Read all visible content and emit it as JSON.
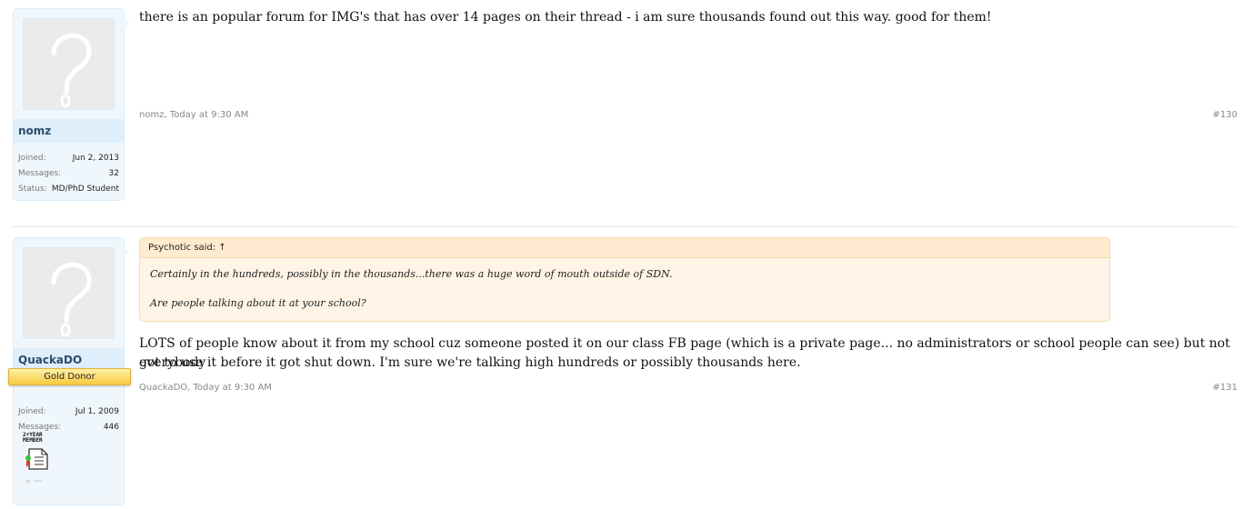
{
  "posts": [
    {
      "username": "nomz",
      "stats": [
        {
          "label": "Joined:",
          "value": "Jun 2, 2013"
        },
        {
          "label": "Messages:",
          "value": "32"
        },
        {
          "label": "Status:",
          "value": "MD/PhD Student"
        }
      ],
      "message": "there is an popular forum for IMG's that has over 14 pages on their thread - i am sure thousands found out this way. good for them!",
      "meta": "nomz, Today at 9:30 AM",
      "post_number": "#130"
    },
    {
      "username": "QuackaDO",
      "banner": "Gold Donor",
      "stats": [
        {
          "label": "Joined:",
          "value": "Jul 1, 2009"
        },
        {
          "label": "Messages:",
          "value": "446"
        }
      ],
      "badge_text": "2+YEAR MEMBER",
      "quote": {
        "author_line": "Psychotic said: ↑",
        "lines": [
          "Certainly in the hundreds, possibly in the thousands...there was a huge word of mouth outside of SDN.",
          "Are people talking about it at your school?"
        ]
      },
      "message_line1": "LOTS of people know about it from my school cuz someone posted it on our class FB page (which is a private page... no administrators or school people can see) but not everybody",
      "message_line2": "got to use it before it got shut down. I'm sure we're talking high hundreds or possibly thousands here.",
      "meta": "QuackaDO, Today at 9:30 AM",
      "post_number": "#131"
    }
  ],
  "colors": {
    "username": "#2b4d6c",
    "card_bg": "#f0f7fc",
    "quote_bg": "#fff4e5",
    "donor_gold": "#f7c93e"
  }
}
